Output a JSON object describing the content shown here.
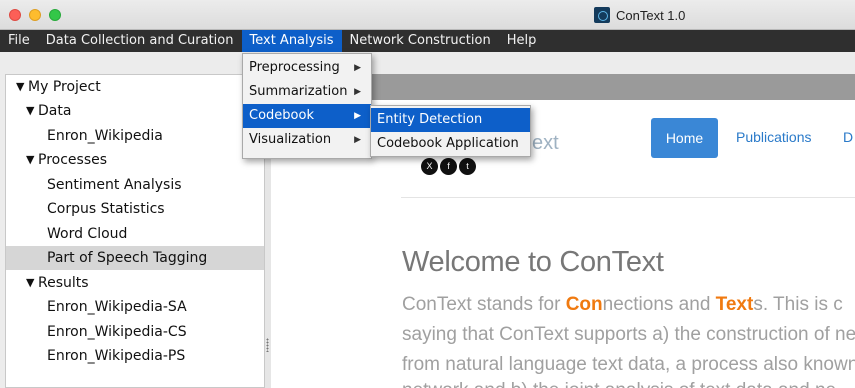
{
  "window": {
    "title": "ConText 1.0"
  },
  "menubar": {
    "items": [
      "File",
      "Data Collection and Curation",
      "Text Analysis",
      "Network Construction",
      "Help"
    ],
    "active_index": 2
  },
  "text_analysis_menu": {
    "items": [
      {
        "label": "Preprocessing",
        "has_submenu": true
      },
      {
        "label": "Summarization",
        "has_submenu": true
      },
      {
        "label": "Codebook",
        "has_submenu": true
      },
      {
        "label": "Visualization",
        "has_submenu": true
      }
    ],
    "highlighted": "Codebook"
  },
  "codebook_submenu": {
    "items": [
      "Entity Detection",
      "Codebook Application"
    ],
    "highlighted": "Entity Detection"
  },
  "tree": {
    "project": "My Project",
    "data_folder": "Data",
    "data_items": [
      "Enron_Wikipedia"
    ],
    "processes_folder": "Processes",
    "process_items": [
      "Sentiment Analysis",
      "Corpus Statistics",
      "Word Cloud",
      "Part of Speech Tagging"
    ],
    "selected": "Part of Speech Tagging",
    "results_folder": "Results",
    "result_items": [
      "Enron_Wikipedia-SA",
      "Enron_Wikipedia-CS",
      "Enron_Wikipedia-PS"
    ]
  },
  "webpage": {
    "brand_fragment": "ext",
    "nav": {
      "home": "Home",
      "publications": "Publications",
      "next": "D"
    },
    "social": [
      "X",
      "f",
      "t"
    ],
    "welcome": "Welcome to ConText",
    "intro": {
      "l1_pre": "ConText stands for ",
      "l1_hl1": "Con",
      "l1_mid": "nections and ",
      "l1_hl2": "Text",
      "l1_post": "s. This is c",
      "l2": "saying that ConText supports a) the construction of ne",
      "l3": "from natural language text data, a process also known",
      "l4": "network and b) the joint analysis of text data and ne"
    }
  },
  "colors": {
    "menu_highlight": "#0d5fc9",
    "home_button": "#3a87d6",
    "accent_orange": "#f07a10"
  }
}
